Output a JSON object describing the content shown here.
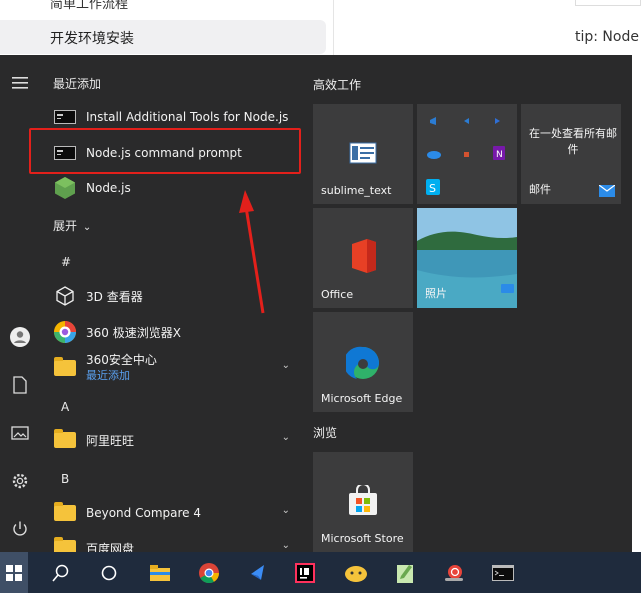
{
  "background_page": {
    "sidebar_prev_item": "简单工作流程",
    "sidebar_active_item": "开发环境安装",
    "tip_text": "tip: Node"
  },
  "start_menu": {
    "recent_header": "最近添加",
    "recent_apps": [
      {
        "label": "Install Additional Tools for Node.js",
        "icon": "cmd-icon"
      },
      {
        "label": "Node.js command prompt",
        "icon": "cmd-icon"
      },
      {
        "label": "Node.js",
        "icon": "nodejs-icon"
      }
    ],
    "expand_label": "展开",
    "sections": [
      {
        "letter": "#",
        "apps": [
          {
            "label": "3D 查看器",
            "icon": "cube-icon"
          },
          {
            "label": "360 极速浏览器X",
            "icon": "360-browser-icon"
          },
          {
            "label": "360安全中心",
            "sub": "最近添加",
            "icon": "folder-icon",
            "expandable": true
          }
        ]
      },
      {
        "letter": "A",
        "apps": [
          {
            "label": "阿里旺旺",
            "icon": "folder-icon",
            "expandable": true
          }
        ]
      },
      {
        "letter": "B",
        "apps": [
          {
            "label": "Beyond Compare 4",
            "icon": "folder-icon",
            "expandable": true
          },
          {
            "label": "百度网盘",
            "icon": "folder-icon",
            "expandable": true
          }
        ]
      }
    ],
    "tile_groups": [
      {
        "title": "高效工作"
      },
      {
        "title": "浏览"
      }
    ],
    "tiles": {
      "sublime": "sublime_text",
      "mail_header": "在一处查看所有邮件",
      "mail_label": "邮件",
      "office": "Office",
      "photos": "照片",
      "edge": "Microsoft Edge",
      "store": "Microsoft Store"
    }
  },
  "colors": {
    "menu_bg": "#2a2a2b",
    "tile_bg": "#3c3c3d",
    "taskbar_bg": "#1f2b3d",
    "highlight": "#e3201b",
    "accent_link": "#5aa0ef"
  }
}
